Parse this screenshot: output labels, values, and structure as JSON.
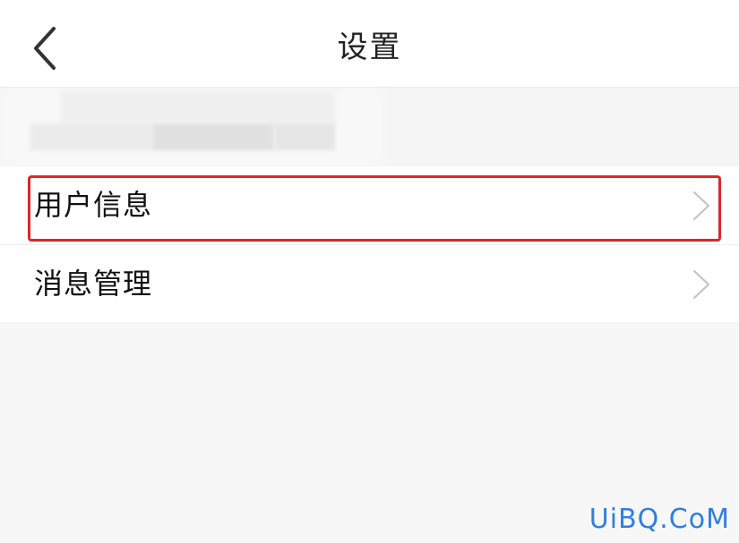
{
  "header": {
    "title": "设置",
    "back_icon": "chevron-left-icon"
  },
  "menu": {
    "items": [
      {
        "label": "用户信息",
        "icon": "chevron-right-icon",
        "highlighted": true
      },
      {
        "label": "消息管理",
        "icon": "chevron-right-icon",
        "highlighted": false
      }
    ]
  },
  "annotation": {
    "highlight_color": "#e0242b"
  },
  "watermark": {
    "text": "UiBQ.CoM",
    "color": "#2f7ee0"
  }
}
